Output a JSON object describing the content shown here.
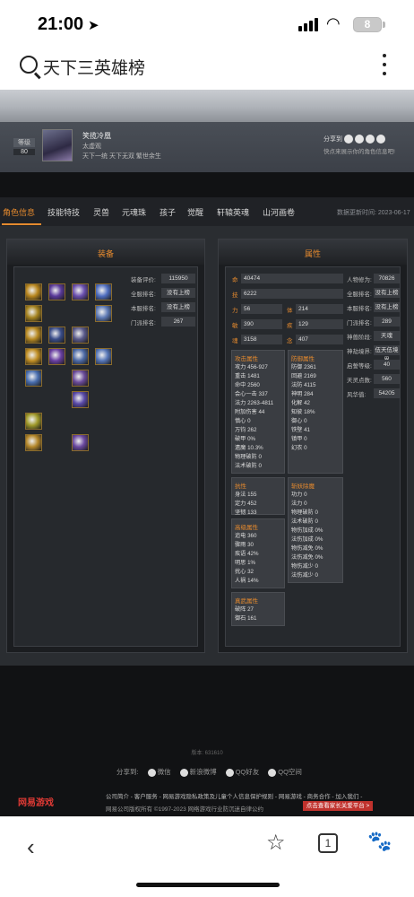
{
  "status": {
    "time": "21:00",
    "battery": "8"
  },
  "search": {
    "query": "天下三英雄榜"
  },
  "profile": {
    "level_label": "等级",
    "level": "80",
    "name": "笑揽冷凰",
    "school": "太虚观",
    "quote": "天下一统 天下无双 繁世余生",
    "share_label": "分享到",
    "share_sub": "快点来展示你的角色信息吧!"
  },
  "tabs": [
    {
      "label": "角色信息"
    },
    {
      "label": "技能特技"
    },
    {
      "label": "灵兽"
    },
    {
      "label": "元魂珠"
    },
    {
      "label": "孩子"
    },
    {
      "label": "觉醒"
    },
    {
      "label": "轩辕英魂"
    },
    {
      "label": "山河画卷"
    }
  ],
  "update_text": "数据更新时间: 2023-06-17",
  "equipment": {
    "title": "装备",
    "rows": [
      {
        "label": "装备评价:",
        "value": "115950"
      },
      {
        "label": "全服排名:",
        "value": "没有上榜"
      },
      {
        "label": "本服排名:",
        "value": "没有上榜"
      },
      {
        "label": "门派排名:",
        "value": "267"
      }
    ]
  },
  "attributes": {
    "title": "属性",
    "ming": {
      "label": "命",
      "value": "40474"
    },
    "ji": {
      "label": "技",
      "value": "6222"
    },
    "pairs": [
      {
        "l1": "力",
        "v1": "56",
        "l2": "体",
        "v2": "214"
      },
      {
        "l1": "敏",
        "v1": "390",
        "l2": "疾",
        "v2": "129"
      },
      {
        "l1": "魂",
        "v1": "3158",
        "l2": "念",
        "v2": "407"
      }
    ],
    "attack": {
      "title": "攻击属性",
      "lines": [
        "攻力 456-927",
        "重击 1481",
        "命中 2560",
        "会心一击 337",
        "法力 2263-4811",
        "附加伤害 44",
        "慎心 0",
        "万钧 262",
        "破甲 0%",
        "遗魔 10.3%",
        "物理破防 0",
        "法术破防 0"
      ]
    },
    "defense": {
      "title": "防御属性",
      "lines": [
        "防御 2361",
        "回避 2169",
        "法防 4115",
        "神明 284",
        "化解 42",
        "知彼 18%",
        "御心 0",
        "铁壁 41",
        "镇甲 0",
        "幻衣 0"
      ]
    },
    "resist": {
      "title": "抗性",
      "lines": [
        "身法 155",
        "定力 452",
        "坚韧 133"
      ]
    },
    "special": {
      "title": "斩妖除魔",
      "lines": [
        "功力 0",
        "法力 0",
        "物理破防 0",
        "法术破防 0",
        "物伤加成 0%",
        "法伤加成 0%",
        "物伤减免 0%",
        "法伤减免 0%",
        "物伤减少 0",
        "法伤减少 0"
      ]
    },
    "advanced": {
      "title": "高级属性",
      "lines": [
        "追电 360",
        "骤雨 30",
        "疾语 42%",
        "明思 1%",
        "扰心 32",
        "人祸 14%"
      ]
    },
    "true": {
      "title": "真武属性",
      "lines": [
        "破阵 27",
        "御石 161"
      ]
    },
    "right": [
      {
        "label": "人物修为:",
        "value": "70826"
      },
      {
        "label": "全服排名:",
        "value": "没有上榜"
      },
      {
        "label": "本服排名:",
        "value": "没有上榜"
      },
      {
        "label": "门派排名:",
        "value": "289"
      },
      {
        "label": "神兽阶段:",
        "value": "天魂"
      },
      {
        "label": "神劫境界:",
        "value": "伍天伍境界"
      },
      {
        "label": "启誓等级:",
        "value": "40"
      },
      {
        "label": "天灵点数:",
        "value": "560"
      },
      {
        "label": "风华值:",
        "value": "54205"
      }
    ]
  },
  "footer": {
    "version": "版本: 631610",
    "share_label": "分享到:",
    "share_items": [
      "微信",
      "新浪微博",
      "QQ好友",
      "QQ空间"
    ],
    "logo": "网易游戏",
    "links": "公司简介 - 客户服务 - 网易游戏隐私政策及儿童个人信息保护规则 - 网易游戏 - 商务合作 - 加入我们 -",
    "copyright": "网易公司版权所有 ©1997-2023     网络游戏行业防沉迷自律公约",
    "parent_button": "点击查看家长关爱平台 >"
  },
  "toolbar": {
    "tabs_count": "1"
  }
}
